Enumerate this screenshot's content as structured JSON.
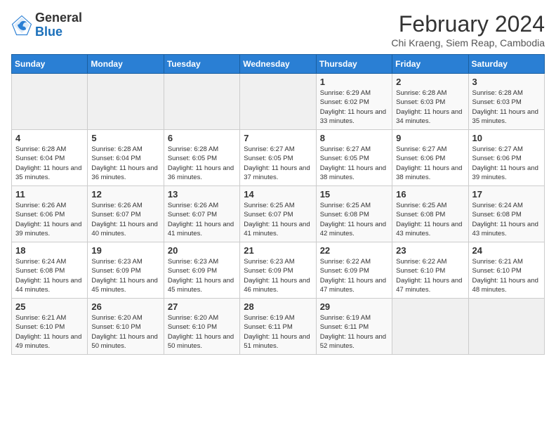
{
  "header": {
    "logo_general": "General",
    "logo_blue": "Blue",
    "title": "February 2024",
    "subtitle": "Chi Kraeng, Siem Reap, Cambodia"
  },
  "weekdays": [
    "Sunday",
    "Monday",
    "Tuesday",
    "Wednesday",
    "Thursday",
    "Friday",
    "Saturday"
  ],
  "weeks": [
    [
      {
        "day": "",
        "info": ""
      },
      {
        "day": "",
        "info": ""
      },
      {
        "day": "",
        "info": ""
      },
      {
        "day": "",
        "info": ""
      },
      {
        "day": "1",
        "info": "Sunrise: 6:29 AM\nSunset: 6:02 PM\nDaylight: 11 hours and 33 minutes."
      },
      {
        "day": "2",
        "info": "Sunrise: 6:28 AM\nSunset: 6:03 PM\nDaylight: 11 hours and 34 minutes."
      },
      {
        "day": "3",
        "info": "Sunrise: 6:28 AM\nSunset: 6:03 PM\nDaylight: 11 hours and 35 minutes."
      }
    ],
    [
      {
        "day": "4",
        "info": "Sunrise: 6:28 AM\nSunset: 6:04 PM\nDaylight: 11 hours and 35 minutes."
      },
      {
        "day": "5",
        "info": "Sunrise: 6:28 AM\nSunset: 6:04 PM\nDaylight: 11 hours and 36 minutes."
      },
      {
        "day": "6",
        "info": "Sunrise: 6:28 AM\nSunset: 6:05 PM\nDaylight: 11 hours and 36 minutes."
      },
      {
        "day": "7",
        "info": "Sunrise: 6:27 AM\nSunset: 6:05 PM\nDaylight: 11 hours and 37 minutes."
      },
      {
        "day": "8",
        "info": "Sunrise: 6:27 AM\nSunset: 6:05 PM\nDaylight: 11 hours and 38 minutes."
      },
      {
        "day": "9",
        "info": "Sunrise: 6:27 AM\nSunset: 6:06 PM\nDaylight: 11 hours and 38 minutes."
      },
      {
        "day": "10",
        "info": "Sunrise: 6:27 AM\nSunset: 6:06 PM\nDaylight: 11 hours and 39 minutes."
      }
    ],
    [
      {
        "day": "11",
        "info": "Sunrise: 6:26 AM\nSunset: 6:06 PM\nDaylight: 11 hours and 39 minutes."
      },
      {
        "day": "12",
        "info": "Sunrise: 6:26 AM\nSunset: 6:07 PM\nDaylight: 11 hours and 40 minutes."
      },
      {
        "day": "13",
        "info": "Sunrise: 6:26 AM\nSunset: 6:07 PM\nDaylight: 11 hours and 41 minutes."
      },
      {
        "day": "14",
        "info": "Sunrise: 6:25 AM\nSunset: 6:07 PM\nDaylight: 11 hours and 41 minutes."
      },
      {
        "day": "15",
        "info": "Sunrise: 6:25 AM\nSunset: 6:08 PM\nDaylight: 11 hours and 42 minutes."
      },
      {
        "day": "16",
        "info": "Sunrise: 6:25 AM\nSunset: 6:08 PM\nDaylight: 11 hours and 43 minutes."
      },
      {
        "day": "17",
        "info": "Sunrise: 6:24 AM\nSunset: 6:08 PM\nDaylight: 11 hours and 43 minutes."
      }
    ],
    [
      {
        "day": "18",
        "info": "Sunrise: 6:24 AM\nSunset: 6:08 PM\nDaylight: 11 hours and 44 minutes."
      },
      {
        "day": "19",
        "info": "Sunrise: 6:23 AM\nSunset: 6:09 PM\nDaylight: 11 hours and 45 minutes."
      },
      {
        "day": "20",
        "info": "Sunrise: 6:23 AM\nSunset: 6:09 PM\nDaylight: 11 hours and 45 minutes."
      },
      {
        "day": "21",
        "info": "Sunrise: 6:23 AM\nSunset: 6:09 PM\nDaylight: 11 hours and 46 minutes."
      },
      {
        "day": "22",
        "info": "Sunrise: 6:22 AM\nSunset: 6:09 PM\nDaylight: 11 hours and 47 minutes."
      },
      {
        "day": "23",
        "info": "Sunrise: 6:22 AM\nSunset: 6:10 PM\nDaylight: 11 hours and 47 minutes."
      },
      {
        "day": "24",
        "info": "Sunrise: 6:21 AM\nSunset: 6:10 PM\nDaylight: 11 hours and 48 minutes."
      }
    ],
    [
      {
        "day": "25",
        "info": "Sunrise: 6:21 AM\nSunset: 6:10 PM\nDaylight: 11 hours and 49 minutes."
      },
      {
        "day": "26",
        "info": "Sunrise: 6:20 AM\nSunset: 6:10 PM\nDaylight: 11 hours and 50 minutes."
      },
      {
        "day": "27",
        "info": "Sunrise: 6:20 AM\nSunset: 6:10 PM\nDaylight: 11 hours and 50 minutes."
      },
      {
        "day": "28",
        "info": "Sunrise: 6:19 AM\nSunset: 6:11 PM\nDaylight: 11 hours and 51 minutes."
      },
      {
        "day": "29",
        "info": "Sunrise: 6:19 AM\nSunset: 6:11 PM\nDaylight: 11 hours and 52 minutes."
      },
      {
        "day": "",
        "info": ""
      },
      {
        "day": "",
        "info": ""
      }
    ]
  ]
}
